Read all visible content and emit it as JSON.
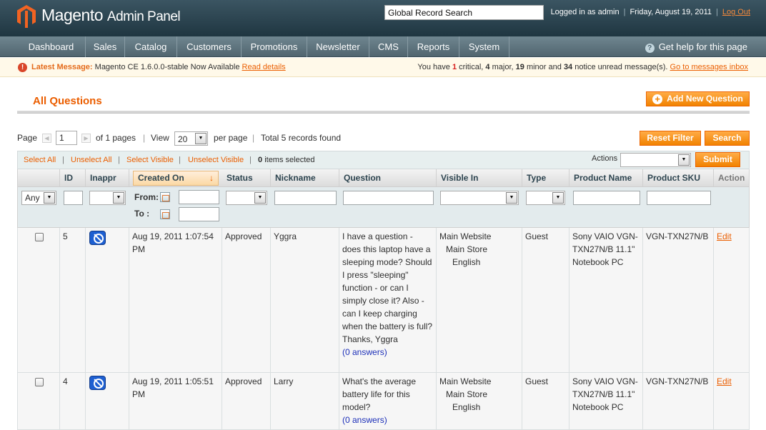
{
  "header": {
    "logo_text": "Magento",
    "logo_sub": "Admin Panel",
    "search_value": "Global Record Search",
    "logged_in": "Logged in as admin",
    "date": "Friday, August 19, 2011",
    "logout": "Log Out"
  },
  "nav": {
    "items": [
      {
        "label": "Dashboard"
      },
      {
        "label": "Sales"
      },
      {
        "label": "Catalog"
      },
      {
        "label": "Customers"
      },
      {
        "label": "Promotions"
      },
      {
        "label": "Newsletter"
      },
      {
        "label": "CMS"
      },
      {
        "label": "Reports"
      },
      {
        "label": "System"
      }
    ],
    "help": "Get help for this page"
  },
  "message": {
    "label": "Latest Message:",
    "text": "Magento CE 1.6.0.0-stable Now Available",
    "read_details": "Read details",
    "you_have": "You have",
    "critical_count": "1",
    "critical_label": "critical,",
    "major_count": "4",
    "major_label": "major,",
    "minor_count": "19",
    "minor_label": "minor and",
    "notice_count": "34",
    "notice_label": "notice unread message(s).",
    "inbox_link": "Go to messages inbox"
  },
  "page": {
    "title": "All Questions",
    "add_button": "Add New Question"
  },
  "pager": {
    "page_label": "Page",
    "page_value": "1",
    "of_pages": "of 1 pages",
    "view_label": "View",
    "view_value": "20",
    "per_page": "per page",
    "total": "Total 5 records found",
    "reset_filter": "Reset Filter",
    "search": "Search"
  },
  "massaction": {
    "select_all": "Select All",
    "unselect_all": "Unselect All",
    "select_visible": "Select Visible",
    "unselect_visible": "Unselect Visible",
    "selected_count": "0",
    "selected_label": "items selected",
    "actions_label": "Actions",
    "submit": "Submit"
  },
  "grid": {
    "columns": [
      "",
      "ID",
      "Inappr",
      "Created On",
      "Status",
      "Nickname",
      "Question",
      "Visible In",
      "Type",
      "Product Name",
      "Product SKU",
      "Action"
    ],
    "filter": {
      "any_value": "Any",
      "from_label": "From:",
      "to_label": "To :"
    },
    "rows": [
      {
        "id": "5",
        "created": "Aug 19, 2011 1:07:54 PM",
        "status": "Approved",
        "nickname": "Yggra",
        "question": "I have a question - does this laptop have a sleeping mode? Should I press \"sleeping\" function - or can I simply close it? Also - can I keep charging when the battery is full? Thanks, Yggra",
        "answers": "(0 answers)",
        "visible_website": "Main Website",
        "visible_store": "Main Store",
        "visible_view": "English",
        "type": "Guest",
        "product_name": "Sony VAIO VGN-TXN27N/B 11.1\" Notebook PC",
        "sku": "VGN-TXN27N/B",
        "action": "Edit"
      },
      {
        "id": "4",
        "created": "Aug 19, 2011 1:05:51 PM",
        "status": "Approved",
        "nickname": "Larry",
        "question": "What's the average battery life for this model?",
        "answers": "(0 answers)",
        "visible_website": "Main Website",
        "visible_store": "Main Store",
        "visible_view": "English",
        "type": "Guest",
        "product_name": "Sony VAIO VGN-TXN27N/B 11.1\" Notebook PC",
        "sku": "VGN-TXN27N/B",
        "action": "Edit"
      }
    ]
  },
  "colors": {
    "accent": "#eb5e00",
    "header_bg": "#2a4350",
    "nav_bg": "#60757f"
  }
}
